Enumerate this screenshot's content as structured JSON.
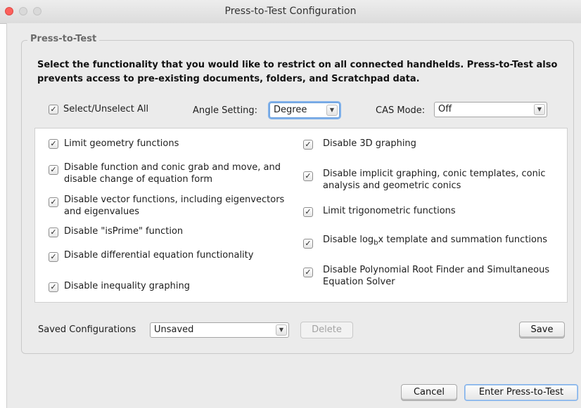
{
  "window": {
    "title": "Press-to-Test Configuration"
  },
  "group": {
    "legend": "Press-to-Test",
    "description": "Select the functionality that you would like to restrict on all connected handhelds. Press-to-Test also prevents access to pre-existing documents, folders, and Scratchpad data."
  },
  "toolbar": {
    "select_all": {
      "label": "Select/Unselect All",
      "checked": true
    },
    "angle": {
      "label": "Angle Setting:",
      "value": "Degree"
    },
    "cas": {
      "label": "CAS Mode:",
      "value": "Off"
    }
  },
  "options_left": [
    {
      "label": "Limit geometry functions",
      "checked": true
    },
    {
      "label": "Disable function and conic grab and move, and",
      "label2": "disable change of equation form",
      "checked": true
    },
    {
      "label": "Disable vector functions, including eigenvectors",
      "label2": "and eigenvalues",
      "checked": true
    },
    {
      "label": "Disable \"isPrime\" function",
      "checked": true
    },
    {
      "label": "Disable differential equation functionality",
      "checked": true
    },
    {
      "label": "Disable inequality graphing",
      "checked": true
    }
  ],
  "options_right": [
    {
      "label": "Disable 3D graphing",
      "checked": true
    },
    {
      "label": "Disable implicit graphing, conic templates, conic",
      "label2": "analysis and geometric conics",
      "checked": true
    },
    {
      "label": "Limit trigonometric functions",
      "checked": true
    },
    {
      "label_pre": "Disable log",
      "label_sub": "b",
      "label_post": "x template and summation functions",
      "checked": true
    },
    {
      "label": "Disable Polynomial Root Finder and Simultaneous",
      "label2": "Equation Solver",
      "checked": true
    }
  ],
  "saved": {
    "label": "Saved Configurations",
    "value": "Unsaved",
    "delete_label": "Delete",
    "save_label": "Save"
  },
  "footer": {
    "cancel_label": "Cancel",
    "enter_label": "Enter Press-to-Test"
  },
  "icons": {
    "check": "✓",
    "dropdown": "▼"
  }
}
